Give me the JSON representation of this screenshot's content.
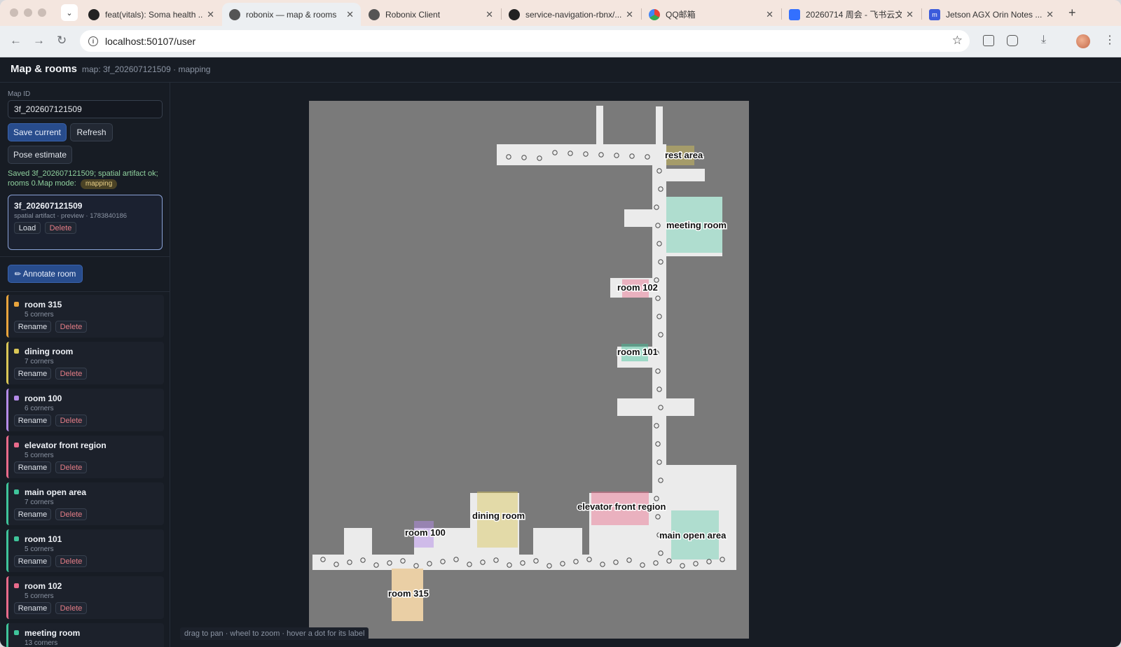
{
  "browser": {
    "tabs": [
      {
        "title": "feat(vitals): Soma health ...",
        "icon": "github-icon"
      },
      {
        "title": "robonix — map & rooms",
        "icon": "globe-icon",
        "active": true
      },
      {
        "title": "Robonix Client",
        "icon": "globe-icon"
      },
      {
        "title": "service-navigation-rbnx/...",
        "icon": "github-icon"
      },
      {
        "title": "QQ邮箱",
        "icon": "qq-mail-icon"
      },
      {
        "title": "20260714 周会 - 飞书云文...",
        "icon": "doc-icon"
      },
      {
        "title": "Jetson AGX Orin Notes ...",
        "icon": "m-icon"
      }
    ],
    "url": "localhost:50107/user"
  },
  "app": {
    "title": "Map & rooms",
    "subtitle": "map: 3f_202607121509 · mapping"
  },
  "sidebar": {
    "map_id_label": "Map ID",
    "map_id_value": "3f_202607121509",
    "save_label": "Save current",
    "refresh_label": "Refresh",
    "pose_label": "Pose estimate",
    "status_text": "Saved 3f_202607121509; spatial artifact ok; rooms 0.Map mode:",
    "mode_chip": "mapping",
    "artifact": {
      "name": "3f_202607121509",
      "meta": "spatial artifact · preview · 1783840186",
      "load_label": "Load",
      "delete_label": "Delete"
    },
    "annotate_label": "✏ Annotate room",
    "rename_label": "Rename",
    "delete_label": "Delete",
    "rooms": [
      {
        "name": "room 315",
        "corners": "5 corners",
        "color": "#e8a43c"
      },
      {
        "name": "dining room",
        "corners": "7 corners",
        "color": "#d9c656"
      },
      {
        "name": "room 100",
        "corners": "6 corners",
        "color": "#b48be8"
      },
      {
        "name": "elevator front region",
        "corners": "5 corners",
        "color": "#e86a8a"
      },
      {
        "name": "main open area",
        "corners": "7 corners",
        "color": "#3fc49a"
      },
      {
        "name": "room 101",
        "corners": "5 corners",
        "color": "#3fc49a"
      },
      {
        "name": "room 102",
        "corners": "5 corners",
        "color": "#e86a8a"
      },
      {
        "name": "meeting room",
        "corners": "13 corners",
        "color": "#3fc49a"
      }
    ]
  },
  "map": {
    "hint": "drag to pan · wheel to zoom · hover a dot for its label",
    "labels": {
      "rest_area": "rest area",
      "meeting_room": "meeting room",
      "room_102": "room 102",
      "room_101": "room 101",
      "dining_room": "dining room",
      "elevator_front": "elevator front region",
      "room_100": "room 100",
      "main_open_area": "main open area",
      "room_315": "room 315"
    }
  }
}
